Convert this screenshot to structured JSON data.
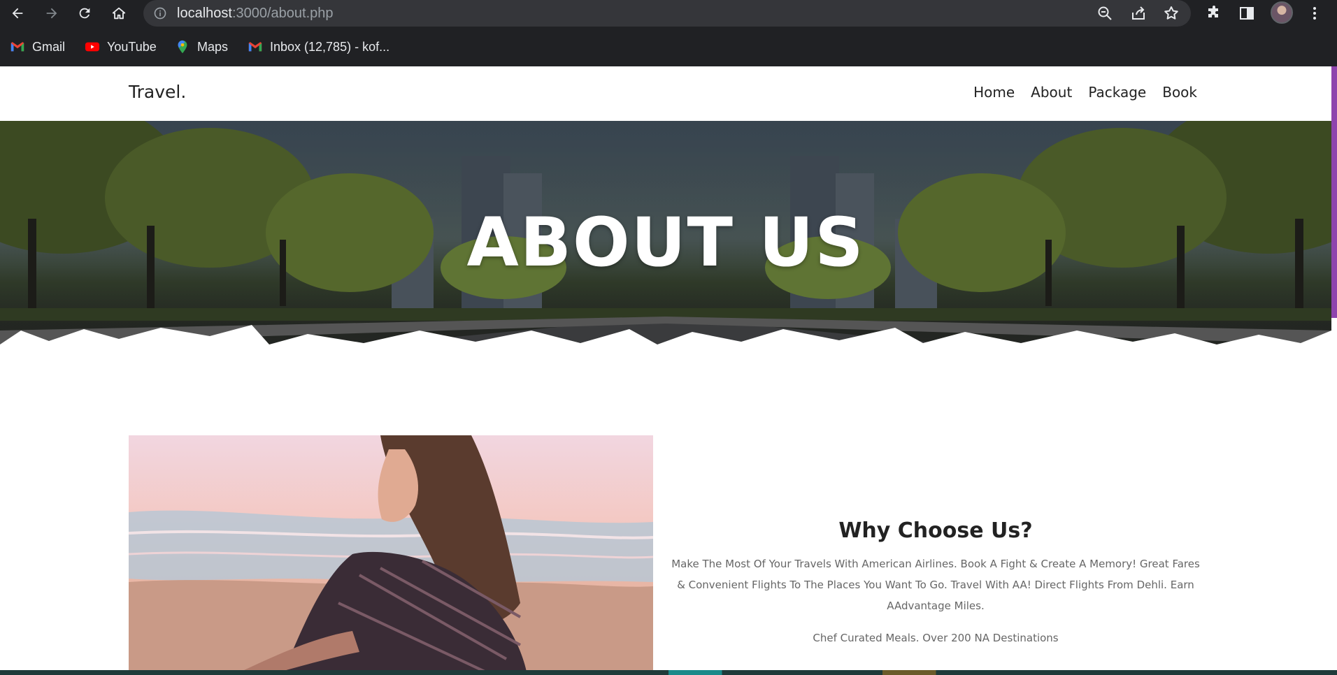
{
  "browser": {
    "url_host": "localhost",
    "url_path": ":3000/about.php",
    "bookmarks": [
      {
        "label": "Gmail",
        "icon": "gmail-icon"
      },
      {
        "label": "YouTube",
        "icon": "youtube-icon"
      },
      {
        "label": "Maps",
        "icon": "maps-icon"
      },
      {
        "label": "Inbox (12,785) - kof...",
        "icon": "gmail-icon"
      }
    ]
  },
  "site": {
    "logo": "Travel.",
    "nav": [
      {
        "label": "Home"
      },
      {
        "label": "About"
      },
      {
        "label": "Package"
      },
      {
        "label": "Book"
      }
    ]
  },
  "hero": {
    "title": "ABOUT US"
  },
  "about": {
    "heading": "Why Choose Us?",
    "text": "Make The Most Of Your Travels With American Airlines. Book A Fight & Create A Memory! Great Fares & Convenient Flights To The Places You Want To Go. Travel With AA! Direct Flights From Dehli. Earn AAdvantage Miles.",
    "subtext": "Chef Curated Meals. Over 200 NA Destinations"
  },
  "colors": {
    "chrome_bg": "#202124",
    "omnibox_bg": "#35363a",
    "scroll_accent": "#8e44ad",
    "heading_text": "#222222",
    "body_text": "#666666"
  }
}
